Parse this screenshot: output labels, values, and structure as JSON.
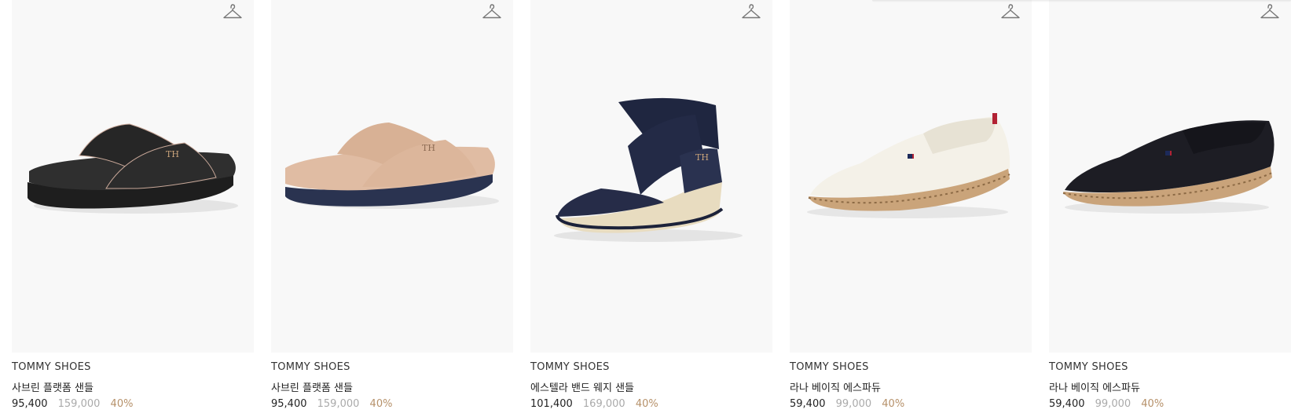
{
  "products": [
    {
      "brand": "TOMMY SHOES",
      "name": "사브린 플랫폼 샌들",
      "sale_price": "95,400",
      "original_price": "159,000",
      "discount": "40%",
      "image_icon": "black-platform-sandal-image",
      "shoe_color": "#2b2b2b"
    },
    {
      "brand": "TOMMY SHOES",
      "name": "사브린 플랫폼 샌들",
      "sale_price": "95,400",
      "original_price": "159,000",
      "discount": "40%",
      "image_icon": "beige-platform-sandal-image",
      "shoe_color": "#d9b49a"
    },
    {
      "brand": "TOMMY SHOES",
      "name": "에스텔라 밴드 웨지 샌들",
      "sale_price": "101,400",
      "original_price": "169,000",
      "discount": "40%",
      "image_icon": "navy-wedge-sandal-image",
      "shoe_color": "#222a44"
    },
    {
      "brand": "TOMMY SHOES",
      "name": "라나 베이직 에스파듀",
      "sale_price": "59,400",
      "original_price": "99,000",
      "discount": "40%",
      "image_icon": "white-espadrille-image",
      "shoe_color": "#f3f0e6"
    },
    {
      "brand": "TOMMY SHOES",
      "name": "라나 베이직 에스파듀",
      "sale_price": "59,400",
      "original_price": "99,000",
      "discount": "40%",
      "image_icon": "black-espadrille-image",
      "shoe_color": "#1f1f26"
    }
  ],
  "icons": {
    "wishlist": "hanger-icon"
  },
  "colors": {
    "discount": "#b6916a",
    "original_price": "#aaaaaa",
    "card_background": "#f8f8f8"
  }
}
